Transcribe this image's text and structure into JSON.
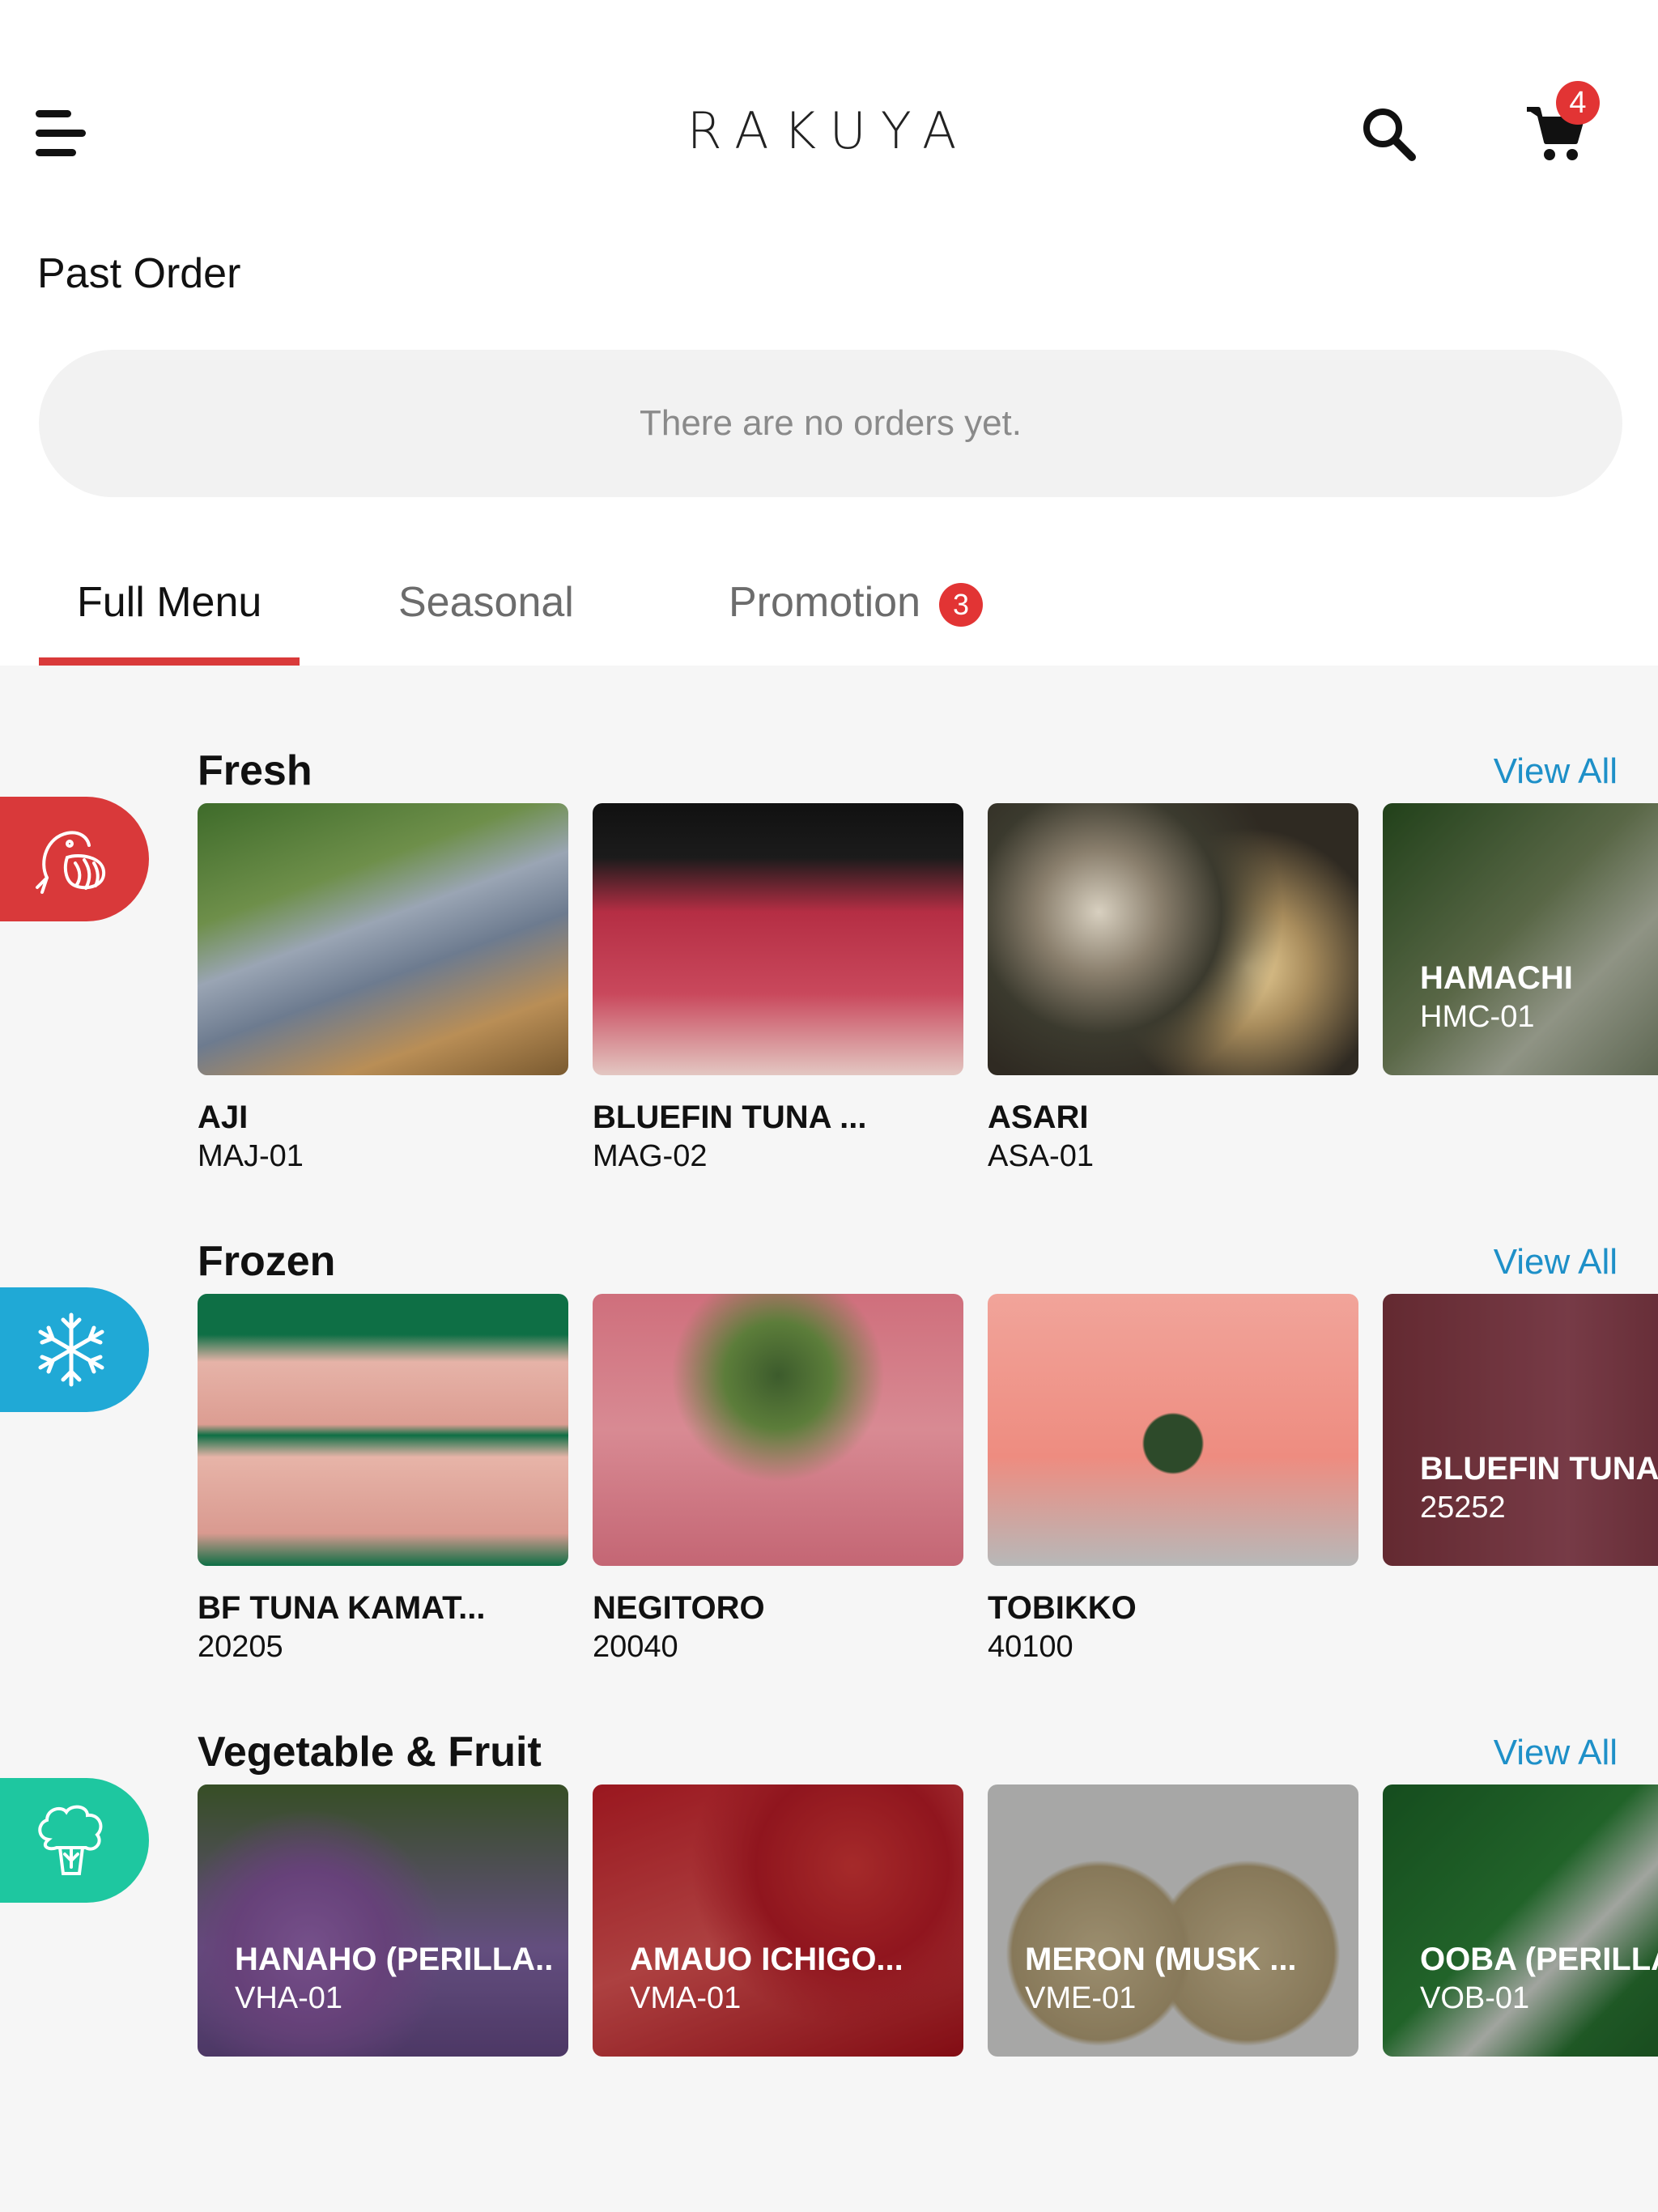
{
  "header": {
    "logo": "RAKUYA",
    "cart_count": "4",
    "menu_icon": "hamburger-icon",
    "search_icon": "search-icon",
    "cart_icon": "cart-icon"
  },
  "past_order": {
    "title": "Past Order",
    "empty_message": "There are no orders yet."
  },
  "tabs": [
    {
      "label": "Full Menu",
      "active": true
    },
    {
      "label": "Seasonal",
      "active": false
    },
    {
      "label": "Promotion",
      "active": false,
      "badge": "3"
    }
  ],
  "colors": {
    "accent_red": "#d9393a",
    "frozen_blue": "#20a9d6",
    "vegetable_green": "#1ec7a0",
    "link_blue": "#1e90c8"
  },
  "sections": [
    {
      "title": "Fresh",
      "view_all": "View All",
      "icon": "fish-shell-icon",
      "items": [
        {
          "name": "AJI",
          "code": "MAJ-01"
        },
        {
          "name": "BLUEFIN TUNA ...",
          "code": "MAG-02"
        },
        {
          "name": "ASARI",
          "code": "ASA-01"
        },
        {
          "name": "HAMACHI",
          "code": "HMC-01"
        }
      ]
    },
    {
      "title": "Frozen",
      "view_all": "View All",
      "icon": "snowflake-icon",
      "items": [
        {
          "name": "BF TUNA KAMAT...",
          "code": "20205"
        },
        {
          "name": "NEGITORO",
          "code": "20040"
        },
        {
          "name": "TOBIKKO",
          "code": "40100"
        },
        {
          "name": "BLUEFIN TUNA",
          "code": "25252"
        }
      ]
    },
    {
      "title": "Vegetable & Fruit",
      "view_all": "View All",
      "icon": "broccoli-icon",
      "items": [
        {
          "name": "HANAHO (PERILLA..",
          "code": "VHA-01"
        },
        {
          "name": "AMAUO ICHIGO...",
          "code": "VMA-01"
        },
        {
          "name": "MERON (MUSK ...",
          "code": "VME-01"
        },
        {
          "name": "OOBA (PERILLA",
          "code": "VOB-01"
        }
      ]
    }
  ]
}
